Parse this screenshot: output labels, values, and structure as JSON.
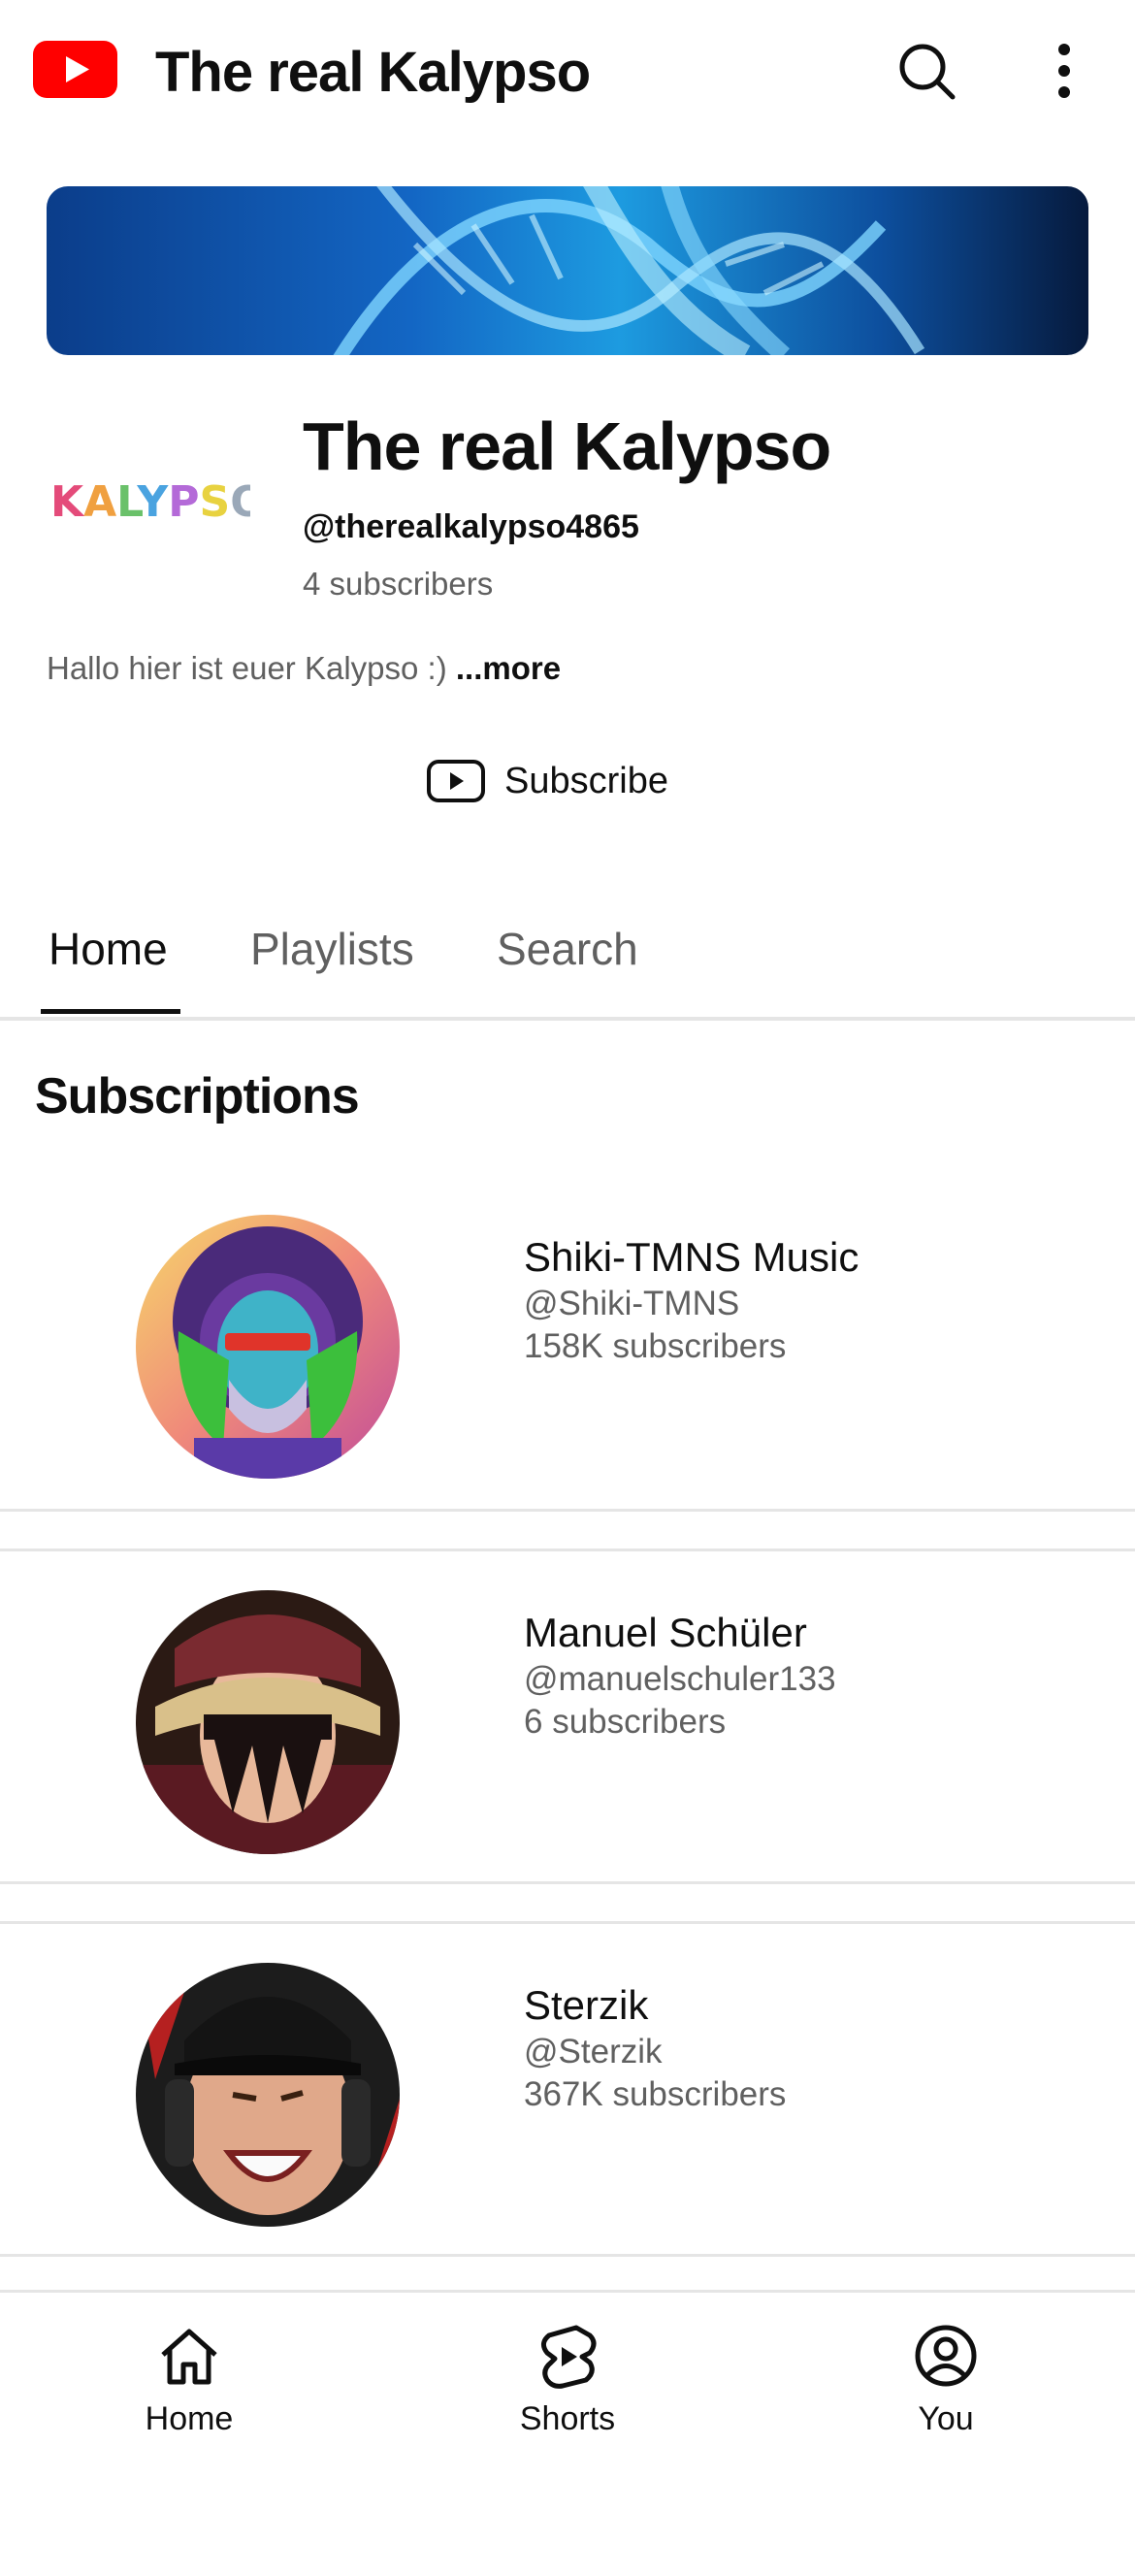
{
  "header": {
    "title": "The real Kalypso",
    "logo_icon": "youtube-logo-icon",
    "search_icon": "search-icon",
    "more_icon": "more-vertical-icon"
  },
  "channel": {
    "avatar_text": "KALYPSO",
    "title": "The real Kalypso",
    "handle": "@therealkalypso4865",
    "subscribers": "4 subscribers",
    "description": "Hallo hier ist euer Kalypso :)",
    "more_label": "...more",
    "subscribe_label": "Subscribe"
  },
  "tabs": [
    {
      "label": "Home",
      "active": true
    },
    {
      "label": "Playlists",
      "active": false
    },
    {
      "label": "Search",
      "active": false
    }
  ],
  "section_title": "Subscriptions",
  "subscriptions": [
    {
      "name": "Shiki-TMNS Music",
      "handle": "@Shiki-TMNS",
      "subscribers": "158K subscribers"
    },
    {
      "name": "Manuel Schüler",
      "handle": "@manuelschuler133",
      "subscribers": "6 subscribers"
    },
    {
      "name": "Sterzik",
      "handle": "@Sterzik",
      "subscribers": "367K subscribers"
    }
  ],
  "bottom_nav": [
    {
      "label": "Home",
      "icon": "home-icon"
    },
    {
      "label": "Shorts",
      "icon": "shorts-icon"
    },
    {
      "label": "You",
      "icon": "account-icon"
    }
  ],
  "colors": {
    "brand_red": "#ff0000",
    "text_primary": "#0f0f0f",
    "text_secondary": "#606060",
    "divider": "#e5e5e5"
  }
}
